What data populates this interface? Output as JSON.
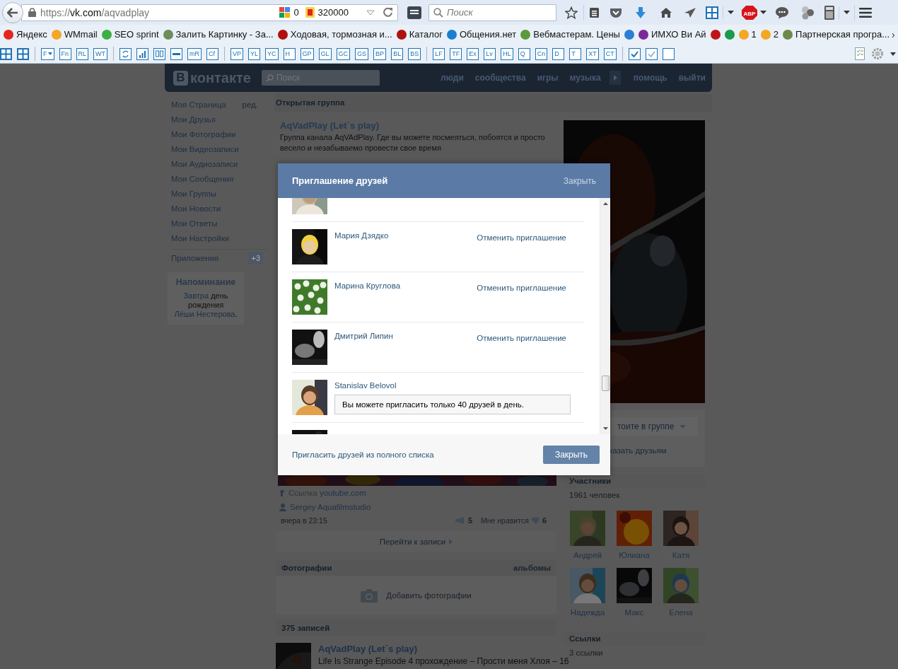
{
  "browser": {
    "address": {
      "scheme": "https://",
      "host": "vk.com",
      "path": "/aqvadplay"
    },
    "google_count": "0",
    "yandex_count": "320000",
    "search": {
      "placeholder": "Поиск"
    },
    "abp_label": "ABP"
  },
  "bookmarks": [
    {
      "label": "Яндекс",
      "color": "#e52620"
    },
    {
      "label": "WMmail",
      "color": "#f5a623"
    },
    {
      "label": "SEO sprint",
      "color": "#3cb043"
    },
    {
      "label": "Залить Картинку - За...",
      "color": "#6b8e5a"
    },
    {
      "label": "Ходовая, тормозная и...",
      "color": "#b01010"
    },
    {
      "label": "Каталог",
      "color": "#b01010"
    },
    {
      "label": "Общения.нет",
      "color": "#1a7fd0"
    },
    {
      "label": "Вебмастерам. Цены",
      "color": "#5b9a3a"
    },
    {
      "color": "#2a7fd4"
    },
    {
      "label": "ИМХО Ви Ай",
      "color": "#7a2a9a"
    },
    {
      "color": "#c0141a"
    },
    {
      "color": "#1a9a4a"
    },
    {
      "label": "1",
      "color": "#f5a623"
    },
    {
      "label": "2",
      "color": "#f5a623"
    },
    {
      "label": "Партнерская програ...",
      "color": "#6b8a4a"
    }
  ],
  "bookmarks_more": "›",
  "toolbar": [
    [
      {
        "kind": "grid"
      },
      {
        "kind": "grid"
      }
    ],
    [
      {
        "kind": "menu-label",
        "label": "F"
      },
      {
        "kind": "label",
        "label": "Fn"
      },
      {
        "kind": "label",
        "label": "RL"
      },
      {
        "kind": "label",
        "label": "WT"
      }
    ],
    [
      {
        "kind": "refresh"
      },
      {
        "kind": "bars"
      },
      {
        "kind": "eyes"
      },
      {
        "kind": "slider"
      },
      {
        "kind": "label",
        "label": "mR"
      },
      {
        "kind": "label",
        "label": "Cf"
      }
    ],
    [
      {
        "kind": "label",
        "label": "VP"
      },
      {
        "kind": "label",
        "label": "YL"
      },
      {
        "kind": "label",
        "label": "YC"
      },
      {
        "kind": "label",
        "label": "H"
      },
      {
        "kind": "label",
        "label": "GP"
      },
      {
        "kind": "label",
        "label": "GL"
      },
      {
        "kind": "label",
        "label": "GC"
      },
      {
        "kind": "label",
        "label": "GS"
      },
      {
        "kind": "label",
        "label": "BP"
      },
      {
        "kind": "label",
        "label": "BL"
      },
      {
        "kind": "label",
        "label": "BS"
      }
    ],
    [
      {
        "kind": "label",
        "label": "LF"
      },
      {
        "kind": "label",
        "label": "TF"
      },
      {
        "kind": "label",
        "label": "Ex"
      },
      {
        "kind": "label",
        "label": "Lv"
      },
      {
        "kind": "label",
        "label": "HL"
      },
      {
        "kind": "label",
        "label": "Q"
      },
      {
        "kind": "label",
        "label": "Cn"
      },
      {
        "kind": "label",
        "label": "D"
      },
      {
        "kind": "label",
        "label": "T"
      },
      {
        "kind": "label",
        "label": "XT"
      },
      {
        "kind": "label",
        "label": "CT"
      }
    ],
    [
      {
        "kind": "check"
      },
      {
        "kind": "check-light"
      },
      {
        "kind": "blank"
      }
    ]
  ],
  "vk": {
    "logo": {
      "mark": "В",
      "text": "контакте"
    },
    "search": {
      "placeholder": "Поиск"
    },
    "nav": [
      "люди",
      "сообщества",
      "игры",
      "музыка"
    ],
    "nav_right": [
      "помощь",
      "выйти"
    ],
    "sidebar": {
      "items": [
        {
          "label": "Моя Страница",
          "edit": "ред."
        },
        {
          "label": "Мои Друзья"
        },
        {
          "label": "Мои Фотографии"
        },
        {
          "label": "Мои Видеозаписи"
        },
        {
          "label": "Мои Аудиозаписи"
        },
        {
          "label": "Мои Сообщения"
        },
        {
          "label": "Мои Группы"
        },
        {
          "label": "Мои Новости"
        },
        {
          "label": "Мои Ответы"
        },
        {
          "label": "Мои Настройки"
        }
      ],
      "apps": {
        "label": "Приложения",
        "badge": "+3"
      },
      "reminder": {
        "title": "Напоминание",
        "parts": [
          {
            "text": "Завтра",
            "link": true
          },
          {
            "text": " день рождения ",
            "link": false
          },
          {
            "text": "Лёши Нестерова",
            "link": true
          },
          {
            "text": ".",
            "link": false
          }
        ]
      }
    },
    "group_type": "Открытая группа",
    "group": {
      "title": "AqVadPlay (Let`s play)",
      "description": "Группа канала AqVAdPlay. Где вы можете посмеяться, побоятся и просто весело и незабываемо провести свое время"
    },
    "post": {
      "link_label": "Ссылка",
      "link": "youtube.com",
      "author": "Sergey Aquafilmstudio",
      "time": "вчера в 23:15",
      "reposts": "5",
      "likes_label": "Мне нравится",
      "likes": "6",
      "goto": "Перейти к записи"
    },
    "photos": {
      "title": "Фотографии",
      "albums": "альбомы",
      "add": "Добавить фотографии"
    },
    "posts_header": "375 записей",
    "last_post": {
      "title": "AqVadPlay (Let`s play)",
      "text": "Life Is Strange Episode 4 прохождение – Прости меня Хлоя – 16"
    },
    "join": {
      "button": "тоите в группе",
      "tell": "казать друзьям"
    },
    "members": {
      "title": "Участники",
      "count": "1961 человек",
      "people": [
        "Андрей",
        "Юлиана",
        "Катя",
        "Надежда",
        "Макс",
        "Елена"
      ]
    },
    "links": {
      "title": "Ссылки",
      "count": "3 ссылки"
    }
  },
  "modal": {
    "title": "Приглашение друзей",
    "header_close": "Закрыть",
    "friends": [
      {
        "kind": "cut"
      },
      {
        "kind": "invited",
        "name": "Мария Дзядко",
        "action": "Отменить приглашение"
      },
      {
        "kind": "invited",
        "name": "Марина Круглова",
        "action": "Отменить приглашение"
      },
      {
        "kind": "invited",
        "name": "Дмитрий Липин",
        "action": "Отменить приглашение"
      },
      {
        "kind": "limit",
        "name": "Stanislav Belovol",
        "notice": "Вы можете пригласить только 40 друзей в день."
      },
      {
        "kind": "cut"
      }
    ],
    "footer_link": "Пригласить друзей из полного списка",
    "close_button": "Закрыть"
  }
}
